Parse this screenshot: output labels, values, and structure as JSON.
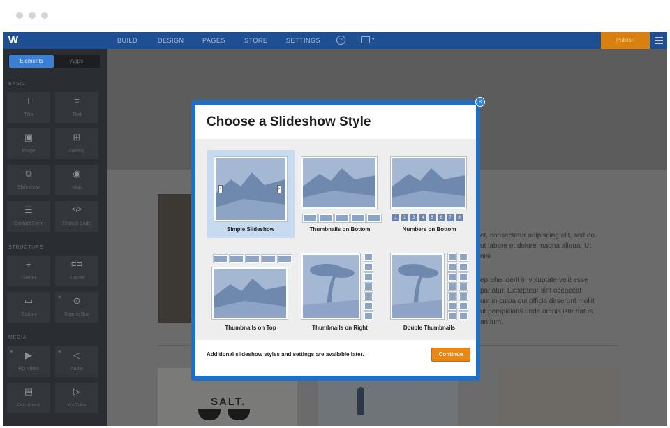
{
  "topbar": {
    "logo": "W",
    "nav": [
      "BUILD",
      "DESIGN",
      "PAGES",
      "STORE",
      "SETTINGS"
    ],
    "help_glyph": "?",
    "publish_label": "Publish",
    "icons": [
      "help-icon",
      "monitor-icon",
      "menu-icon"
    ]
  },
  "sidebar": {
    "tabs": [
      "Elements",
      "Apps"
    ],
    "sections": [
      {
        "label": "BASIC",
        "items": [
          {
            "label": "Title",
            "icon": "T"
          },
          {
            "label": "Text",
            "icon": "≡"
          },
          {
            "label": "Image",
            "icon": "▣"
          },
          {
            "label": "Gallery",
            "icon": "⊞"
          },
          {
            "label": "Slideshow",
            "icon": "⧉"
          },
          {
            "label": "Map",
            "icon": "◉"
          },
          {
            "label": "Contact Form",
            "icon": "☰"
          },
          {
            "label": "Embed Code",
            "icon": "</>"
          }
        ]
      },
      {
        "label": "STRUCTURE",
        "items": [
          {
            "label": "Divider",
            "icon": "÷"
          },
          {
            "label": "Spacer",
            "icon": "⊏⊐"
          },
          {
            "label": "Button",
            "icon": "▭"
          },
          {
            "label": "Search Box",
            "icon": "⊙"
          }
        ]
      },
      {
        "label": "MEDIA",
        "items": [
          {
            "label": "HD Video",
            "icon": "▶"
          },
          {
            "label": "Audio",
            "icon": "◁"
          },
          {
            "label": "Document",
            "icon": "▤"
          },
          {
            "label": "YouTube",
            "icon": "▷"
          }
        ]
      }
    ]
  },
  "canvas": {
    "text_block_1": [
      "et, consectetur adipiscing elit, sed do",
      "ut labore et dolore magna aliqua. Ut",
      "nisi"
    ],
    "text_block_2": [
      "eprehenderit in voluptate velit esse",
      "pariatur. Excepteur sint occaecat",
      "unt in culpa qui officia deserunt mollit",
      "ut perspiciatis unde omnis iste natus",
      "antium."
    ],
    "salt_text": "SALT."
  },
  "modal": {
    "title": "Choose a Slideshow Style",
    "close_glyph": "×",
    "options": [
      {
        "label": "Simple Slideshow",
        "selected": true
      },
      {
        "label": "Thumbnails on Bottom",
        "selected": false
      },
      {
        "label": "Numbers on Bottom",
        "selected": false
      },
      {
        "label": "Thumbnails on Top",
        "selected": false
      },
      {
        "label": "Thumbnails on Right",
        "selected": false
      },
      {
        "label": "Double Thumbnails",
        "selected": false
      }
    ],
    "numbers": [
      "1",
      "2",
      "3",
      "4",
      "5",
      "6",
      "7",
      "8"
    ],
    "footer_note": "Additional slideshow styles and settings are available later.",
    "continue_label": "Continue"
  },
  "colors": {
    "topbar": "#1e4f93",
    "accent_orange": "#e98715",
    "modal_border": "#1f6fc4",
    "selection": "#c6daf0"
  }
}
